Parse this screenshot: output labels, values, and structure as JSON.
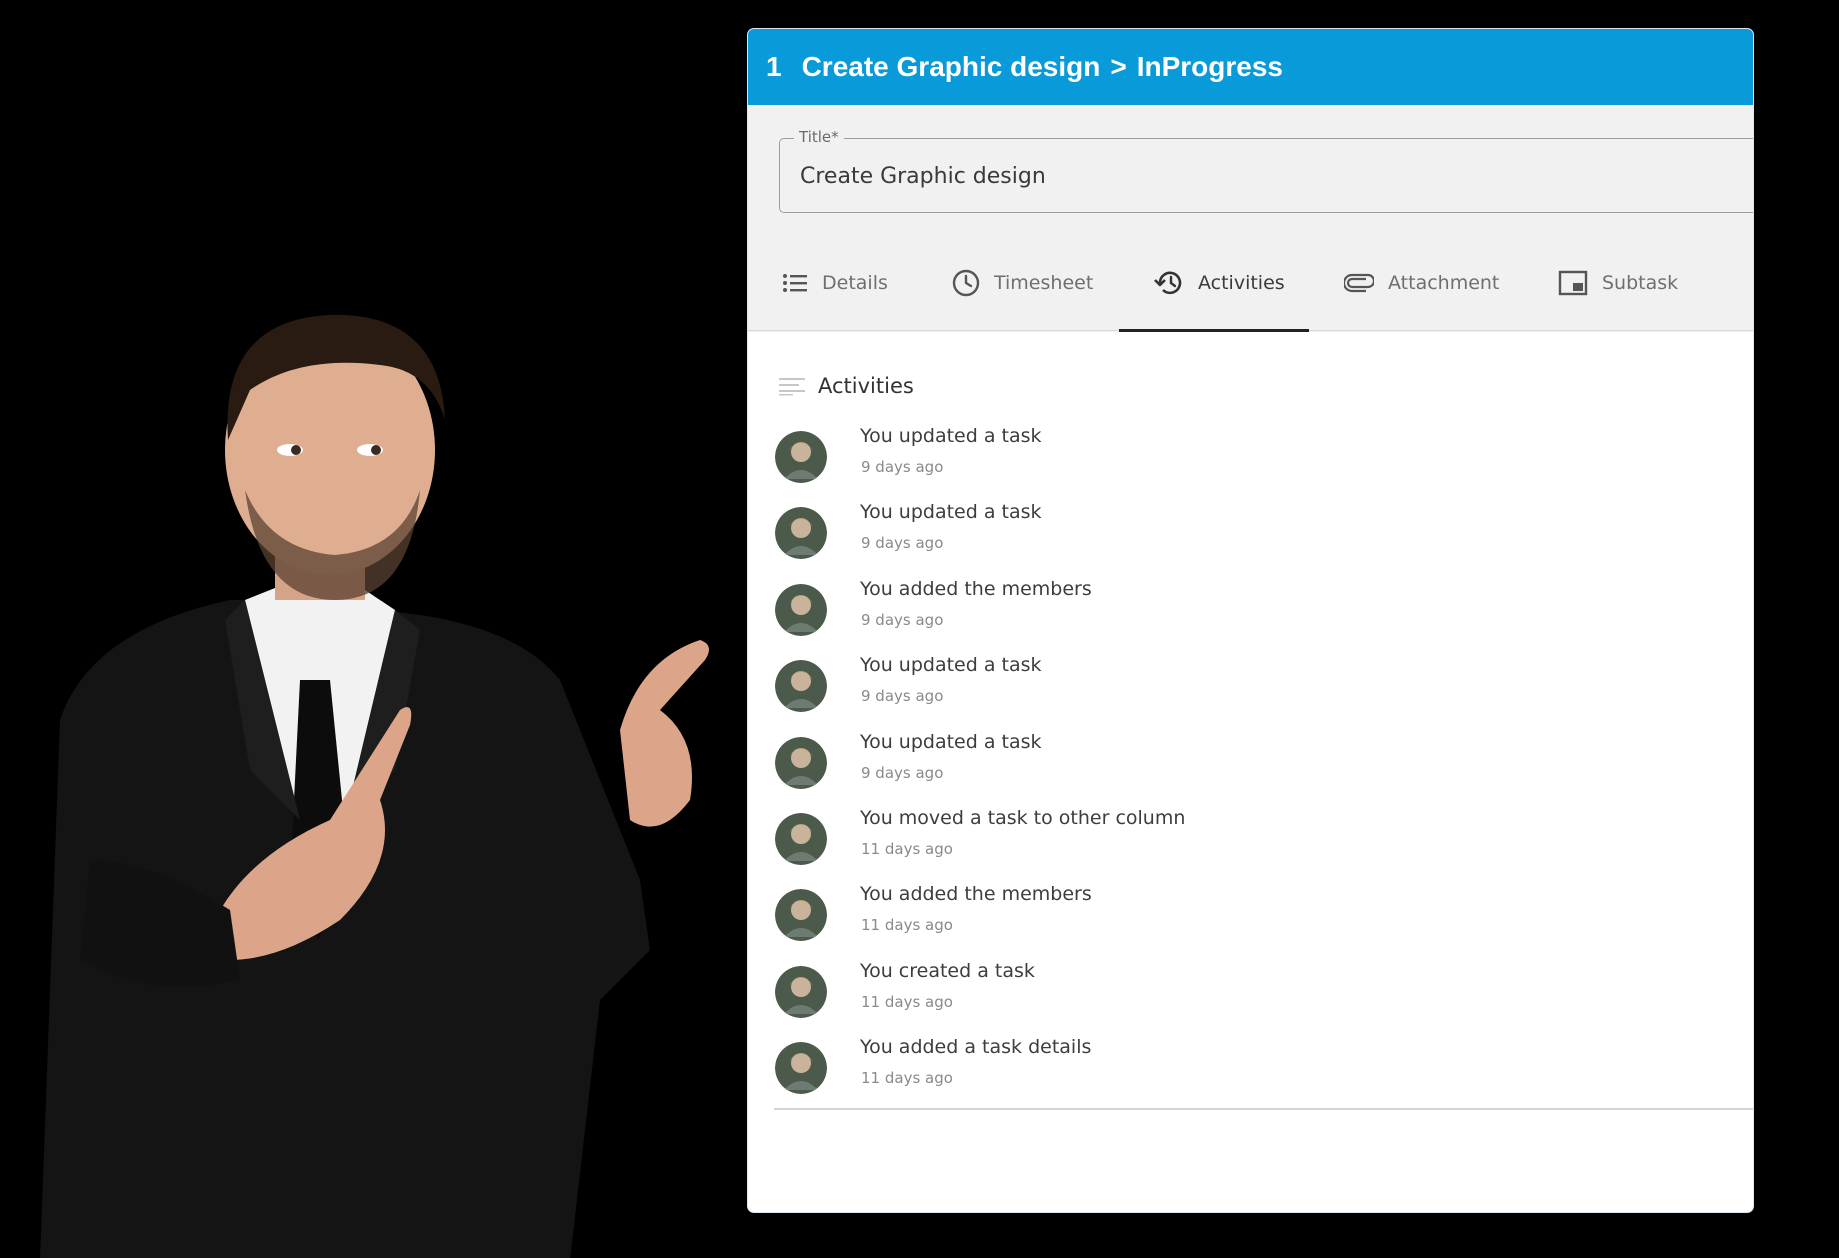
{
  "header": {
    "task_id": "1",
    "task_title": "Create Graphic design",
    "separator": ">",
    "status": "InProgress"
  },
  "title_field": {
    "label": "Title*",
    "value": "Create Graphic design"
  },
  "tabs": [
    {
      "label": "Details",
      "icon": "list-icon",
      "active": false
    },
    {
      "label": "Timesheet",
      "icon": "clock-icon",
      "active": false
    },
    {
      "label": "Activities",
      "icon": "history-icon",
      "active": true
    },
    {
      "label": "Attachment",
      "icon": "paperclip-icon",
      "active": false
    },
    {
      "label": "Subtask",
      "icon": "subtask-icon",
      "active": false
    }
  ],
  "activities": {
    "heading": "Activities",
    "items": [
      {
        "actor": "You",
        "action": "updated a task",
        "time": "9 days ago"
      },
      {
        "actor": "You",
        "action": "updated a task",
        "time": "9 days ago"
      },
      {
        "actor": "You",
        "action": "added the members",
        "time": "9 days ago"
      },
      {
        "actor": "You",
        "action": "updated a task",
        "time": "9 days ago"
      },
      {
        "actor": "You",
        "action": "updated a task",
        "time": "9 days ago"
      },
      {
        "actor": "You",
        "action": "moved a task to other column",
        "time": "11 days ago"
      },
      {
        "actor": "You",
        "action": "added the members",
        "time": "11 days ago"
      },
      {
        "actor": "You",
        "action": "created a task",
        "time": "11 days ago"
      },
      {
        "actor": "You",
        "action": "added a task details",
        "time": "11 days ago"
      }
    ]
  },
  "colors": {
    "header_bg": "#089ad9",
    "page_bg": "#000000",
    "title_area_bg": "#f1f1f1",
    "active_tab_indicator": "#222222"
  }
}
